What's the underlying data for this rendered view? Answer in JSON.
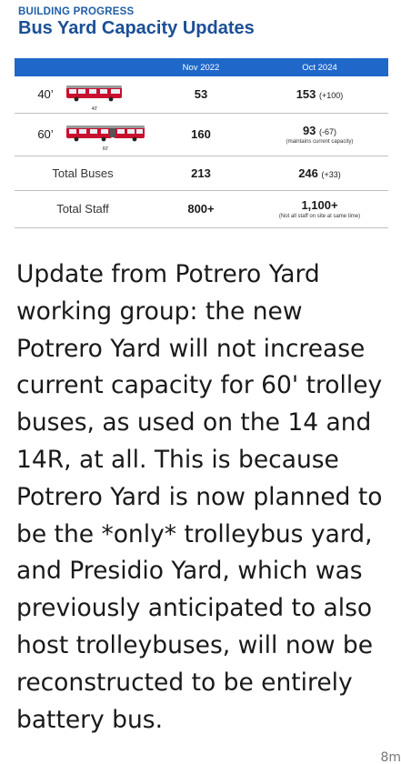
{
  "slide": {
    "eyebrow": "BUILDING PROGRESS",
    "title": "Bus Yard Capacity Updates",
    "table": {
      "col_nov": "Nov 2022",
      "col_oct": "Oct 2024",
      "rows": [
        {
          "label": "40’",
          "bus_caption": "40'",
          "nov": "53",
          "oct": "153",
          "oct_delta": "(+100)",
          "oct_note": ""
        },
        {
          "label": "60’",
          "bus_caption": "60'",
          "nov": "160",
          "oct": "93",
          "oct_delta": "(-67)",
          "oct_note": "(maintains current capacity)"
        },
        {
          "label": "Total Buses",
          "nov": "213",
          "oct": "246",
          "oct_delta": "(+33)",
          "oct_note": ""
        },
        {
          "label": "Total Staff",
          "nov": "800+",
          "oct": "1,100+",
          "oct_delta": "",
          "oct_note": "(Not all staff on site at same time)"
        }
      ]
    },
    "colors": {
      "header_blue": "#1f68c9",
      "title_blue": "#1b4f96",
      "bus_red": "#c8102e"
    }
  },
  "post": {
    "text": "Update from Potrero Yard working group: the new Potrero Yard will not increase current capacity for 60' trolley buses, as used on the 14 and 14R, at all. This is because Potrero Yard is now planned to be the *only* trolleybus yard, and Presidio Yard, which was previously anticipated to also host trolleybuses, will now be reconstructed to be entirely battery bus.",
    "timestamp": "8m"
  }
}
